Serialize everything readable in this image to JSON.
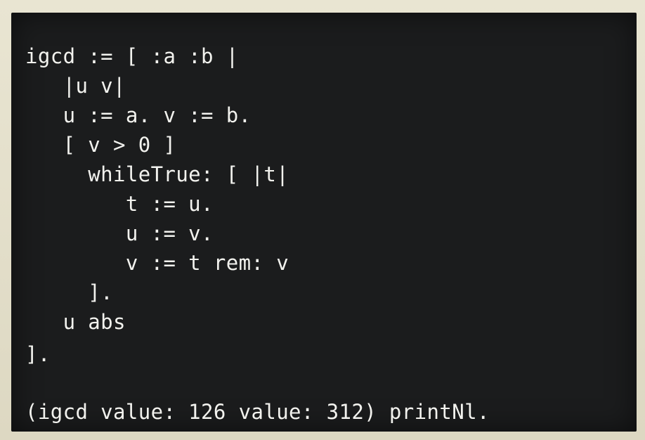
{
  "code": {
    "lines": [
      "igcd := [ :a :b |",
      "   |u v|",
      "   u := a. v := b.",
      "   [ v > 0 ]",
      "     whileTrue: [ |t|",
      "        t := u.",
      "        u := v.",
      "        v := t rem: v",
      "     ].",
      "   u abs",
      "].",
      "(igcd value: 126 value: 312) printNl."
    ]
  },
  "colors": {
    "background": "#1b1c1d",
    "text": "#f2f2ee",
    "frame": "#e6e1cf"
  }
}
